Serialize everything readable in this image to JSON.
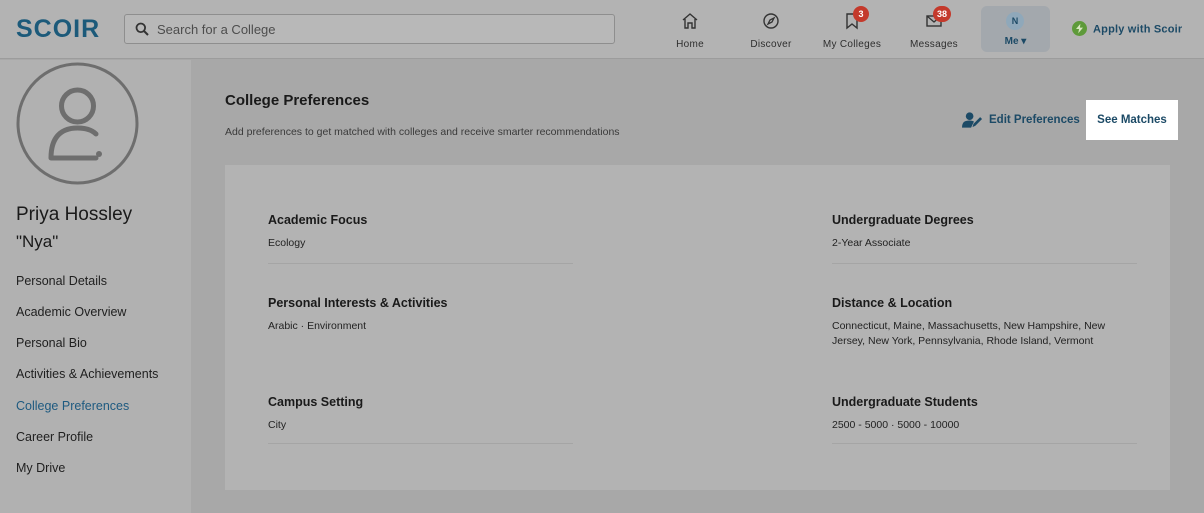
{
  "header": {
    "logo": "SCOIR",
    "search_placeholder": "Search for a College",
    "nav": [
      {
        "label": "Home",
        "icon": "home-icon"
      },
      {
        "label": "Discover",
        "icon": "compass-icon"
      },
      {
        "label": "My Colleges",
        "icon": "bookmark-icon",
        "badge": "3"
      },
      {
        "label": "Messages",
        "icon": "mail-icon",
        "badge": "38"
      }
    ],
    "me": {
      "initial": "N",
      "label": "Me ▾"
    },
    "apply_label": "Apply with Scoir"
  },
  "sidebar": {
    "name": "Priya Hossley",
    "nickname": "\"Nya\"",
    "links": [
      {
        "label": "Personal Details"
      },
      {
        "label": "Academic Overview"
      },
      {
        "label": "Personal Bio"
      },
      {
        "label": "Activities & Achievements"
      },
      {
        "label": "College Preferences",
        "active": true
      },
      {
        "label": "Career Profile"
      },
      {
        "label": "My Drive"
      }
    ]
  },
  "main": {
    "title": "College Preferences",
    "subtitle": "Add preferences to get matched with colleges and receive smarter recommendations",
    "edit_label": "Edit Preferences",
    "see_matches_label": "See Matches",
    "prefs": [
      {
        "label": "Academic Focus",
        "value": "Ecology"
      },
      {
        "label": "Undergraduate Degrees",
        "value": "2-Year Associate"
      },
      {
        "label": "Personal Interests & Activities",
        "value": "Arabic · Environment"
      },
      {
        "label": "Distance & Location",
        "value": "Connecticut, Maine, Massachusetts, New Hampshire, New Jersey, New York, Pennsylvania, Rhode Island, Vermont"
      },
      {
        "label": "Campus Setting",
        "value": "City"
      },
      {
        "label": "Undergraduate Students",
        "value": "2500 - 5000 · 5000 - 10000"
      }
    ]
  },
  "colors": {
    "brand": "#1c5a7a",
    "active_link": "#1e5a80",
    "badge": "#c43a2c",
    "apply_bolt": "#5e9a3a"
  }
}
